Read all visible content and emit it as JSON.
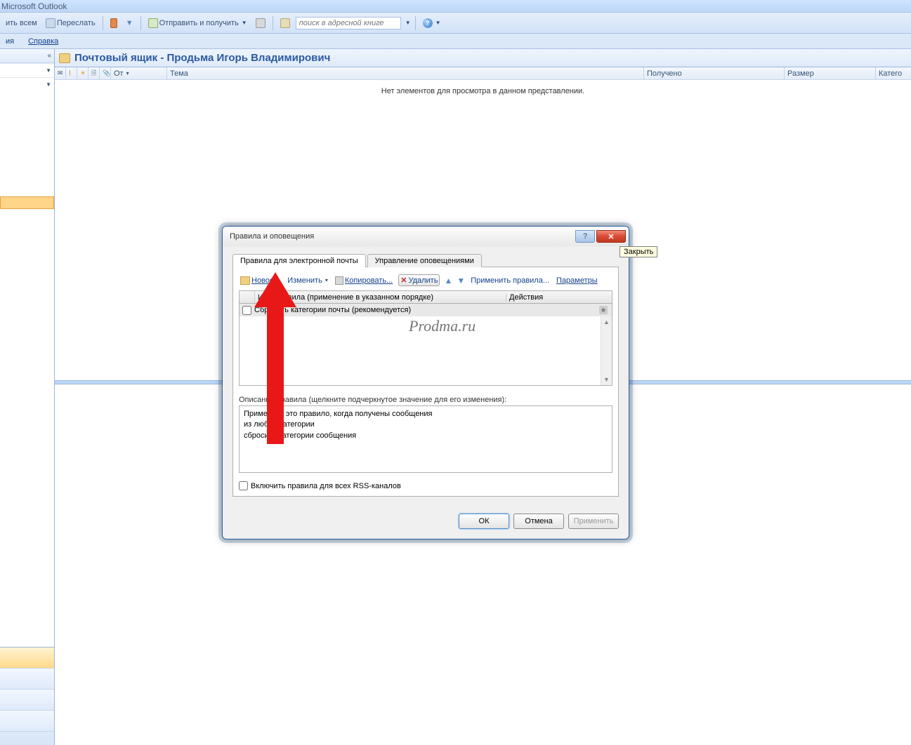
{
  "app_title": "Microsoft Outlook",
  "toolbar": {
    "reply_all": "ить всем",
    "forward": "Переслать",
    "send_receive": "Отправить и получить",
    "search_placeholder": "поиск в адресной книге"
  },
  "menubar": {
    "item1": "ия",
    "item2": "Справка"
  },
  "content": {
    "title": "Почтовый ящик - Продьма Игорь Владимирович",
    "columns": {
      "from": "От",
      "subject": "Тема",
      "received": "Получено",
      "size": "Размер",
      "category": "Катего"
    },
    "empty_message": "Нет элементов для просмотра в данном представлении."
  },
  "dialog": {
    "title": "Правила и оповещения",
    "tabs": {
      "email_rules": "Правила для электронной почты",
      "alerts": "Управление оповещениями"
    },
    "toolbar": {
      "new": "Новое...",
      "edit": "Изменить",
      "copy": "Копировать...",
      "delete": "Удалить",
      "apply": "Применить правила...",
      "options": "Параметры"
    },
    "grid": {
      "col_name": "Имя правила (применение в указанном порядке)",
      "col_actions": "Действия",
      "row1": "Сбросить категории почты (рекомендуется)"
    },
    "description_label": "Описание правила (щелкните подчеркнутое значение для его изменения):",
    "description_lines": {
      "l1": "Применить это правило, когда получены сообщения",
      "l2": "из любой категории",
      "l3": "сбросить категории сообщения"
    },
    "rss_checkbox": "Включить правила для всех RSS-каналов",
    "footer": {
      "ok": "ОК",
      "cancel": "Отмена",
      "apply": "Применить"
    }
  },
  "tooltip": "Закрыть",
  "watermark": "Prodma.ru"
}
